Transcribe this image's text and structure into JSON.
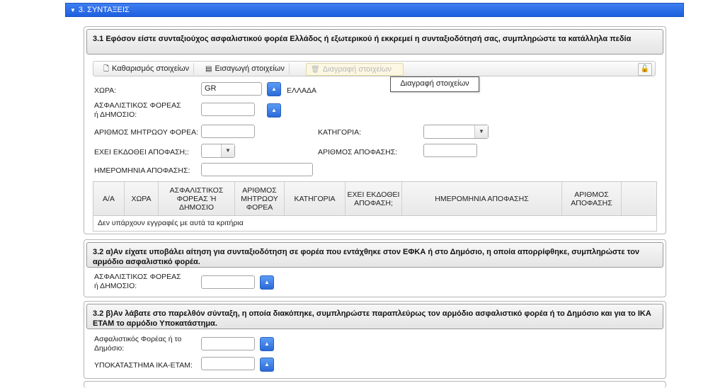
{
  "section_header": {
    "title": "3. ΣΥΝΤΑΞΕΙΣ"
  },
  "panel1": {
    "title": "3.1 Εφόσον είστε συνταξιούχος ασφαλιστικού φορέα Ελλάδος ή εξωτερικού ή εκκρεμεί η συνταξιοδότησή σας, συμπληρώστε τα κατάλληλα πεδία",
    "toolbar": {
      "clear_label": "Καθαρισμός στοιχείων",
      "insert_label": "Εισαγωγή στοιχείων",
      "delete_label": "Διαγραφή στοιχείων"
    },
    "tooltip": "Διαγραφή  στοιχείων",
    "fields": {
      "country_label": "ΧΩΡΑ:",
      "country_value": "GR",
      "country_name": "ΕΛΛΑΔΑ",
      "fund_label": "ΑΣΦΑΛΙΣΤΙΚΟΣ ΦΟΡΕΑΣ ή ΔΗΜΟΣΙΟ:",
      "registry_label": "ΑΡΙΘΜΟΣ ΜΗΤΡΩΟΥ ΦΟΡΕΑ:",
      "category_label": "ΚΑΤΗΓΟΡΙΑ:",
      "decision_issued_label": "ΕΧΕΙ ΕΚΔΟΘΕΙ ΑΠΟΦΑΣΗ;:",
      "decision_number_label": "ΑΡΙΘΜΟΣ ΑΠΟΦΑΣΗΣ:",
      "decision_date_label": "ΗΜΕΡΟΜΗΝΙΑ ΑΠΟΦΑΣΗΣ:"
    },
    "grid": {
      "columns": [
        "Α/Α",
        "ΧΩΡΑ",
        "ΑΣΦΑΛΙΣΤΙΚΟΣ ΦΟΡΕΑΣ Ή ΔΗΜΟΣΙΟ",
        "ΑΡΙΘΜΟΣ ΜΗΤΡΩΟΥ ΦΟΡΕΑ",
        "ΚΑΤΗΓΟΡΙΑ",
        "ΕΧΕΙ ΕΚΔΟΘΕΙ ΑΠΟΦΑΣΗ;",
        "ΗΜΕΡΟΜΗΝΙΑ ΑΠΟΦΑΣΗΣ",
        "ΑΡΙΘΜΟΣ ΑΠΟΦΑΣΗΣ"
      ],
      "empty_message": "Δεν υπάρχουν εγγραφές με αυτά τα κριτήρια"
    }
  },
  "panel2": {
    "title": "3.2 α)Αν είχατε υποβάλει αίτηση για συνταξιοδότηση σε φορέα που εντάχθηκε στον ΕΦΚΑ ή στο Δημόσιο, η οποία απορρίφθηκε, συμπληρώστε τον αρμόδιο ασφαλιστικό φορέα.",
    "fund_label": "ΑΣΦΑΛΙΣΤΙΚΟΣ ΦΟΡΕΑΣ ή ΔΗΜΟΣΙΟ:"
  },
  "panel3": {
    "title": "3.2 β)Αν λάβατε στο παρελθόν σύνταξη, η οποία διακόπηκε, συμπληρώστε παραπλεύρως τον αρμόδιο ασφαλιστικό φορέα ή το Δημόσιο και για το ΙΚΑ ΕΤΑΜ το αρμόδιο Υποκατάστημα.",
    "fund_label": "Ασφαλιστικός Φορέας ή το Δημόσιο:",
    "branch_label": "ΥΠΟΚΑΤΑΣΤΗΜΑ ΙΚΑ-ΕΤΑΜ:"
  },
  "icons": {
    "expand": "triangle-down-icon",
    "lookup": "arrow-up-icon",
    "lock": "lock-icon"
  }
}
